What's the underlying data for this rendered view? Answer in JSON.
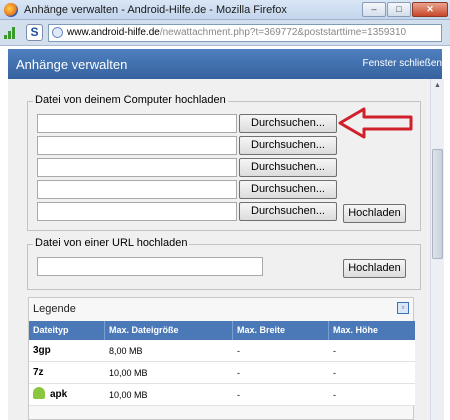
{
  "window": {
    "title": "Anhänge verwalten - Android-Hilfe.de - Mozilla Firefox",
    "minimize": "–",
    "maximize": "□",
    "close": "✕"
  },
  "addressbar": {
    "badge": "S",
    "url_host": "www.android-hilfe.de",
    "url_path": "/newattachment.php?t=369772&poststarttime=1359310"
  },
  "page": {
    "title": "Anhänge verwalten",
    "close_window": "Fenster schließen"
  },
  "computer_upload": {
    "legend": "Datei von deinem Computer hochladen",
    "browse_label": "Durchsuchen...",
    "browse_buttons": [
      "Durchsuchen...",
      "Durchsuchen...",
      "Durchsuchen...",
      "Durchsuchen...",
      "Durchsuchen..."
    ],
    "upload_button": "Hochladen"
  },
  "url_upload": {
    "legend": "Datei von einer URL hochladen",
    "input_value": "",
    "upload_button": "Hochladen"
  },
  "legend_table": {
    "title": "Legende",
    "columns": [
      "Dateityp",
      "Max. Dateigröße",
      "Max. Breite",
      "Max. Höhe"
    ],
    "rows": [
      {
        "type": "3gp",
        "size": "8,00 MB",
        "width": "-",
        "height": "-",
        "icon": ""
      },
      {
        "type": "7z",
        "size": "10,00 MB",
        "width": "-",
        "height": "-",
        "icon": ""
      },
      {
        "type": "apk",
        "size": "10,00 MB",
        "width": "-",
        "height": "-",
        "icon": "android-icon"
      }
    ]
  },
  "colors": {
    "header_blue": "#36639f",
    "annotation_arrow": "#d0202a"
  }
}
